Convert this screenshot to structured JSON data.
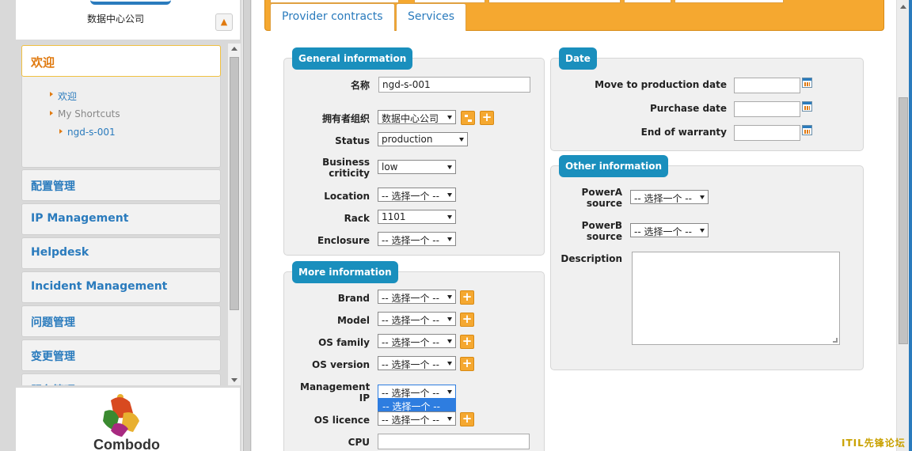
{
  "sidebar": {
    "org_name": "数据中心公司",
    "welcome": {
      "title": "欢迎",
      "shortcuts": [
        "欢迎",
        "My Shortcuts",
        "ngd-s-001"
      ]
    },
    "menu_items": [
      "配置管理",
      "IP Management",
      "Helpdesk",
      "Incident Management",
      "问题管理",
      "变更管理",
      "服务管理"
    ],
    "logo_text": "Combodo"
  },
  "tabs": [
    "Provider contracts",
    "Services"
  ],
  "general": {
    "legend": "General information",
    "name_label": "名称",
    "name_value": "ngd-s-001",
    "org_label": "拥有者组织",
    "org_value": "数据中心公司",
    "status_label": "Status",
    "status_value": "production",
    "criticity_label_1": "Business",
    "criticity_label_2": "criticity",
    "criticity_value": "low",
    "location_label": "Location",
    "location_value": "-- 选择一个 --",
    "rack_label": "Rack",
    "rack_value": "1101",
    "enclosure_label": "Enclosure",
    "enclosure_value": "-- 选择一个 --"
  },
  "more": {
    "legend": "More information",
    "brand_label": "Brand",
    "brand_value": "-- 选择一个 --",
    "model_label": "Model",
    "model_value": "-- 选择一个 --",
    "osfamily_label": "OS family",
    "osfamily_value": "-- 选择一个 --",
    "osversion_label": "OS version",
    "osversion_value": "-- 选择一个 --",
    "mgmtip_label_1": "Management",
    "mgmtip_label_2": "IP",
    "mgmtip_value": "-- 选择一个 --",
    "mgmtip_option": "-- 选择一个 --",
    "oslicence_label": "OS licence",
    "oslicence_value": "-- 选择一个 --",
    "cpu_label": "CPU",
    "cpu_value": ""
  },
  "date": {
    "legend": "Date",
    "move_label": "Move to production date",
    "purchase_label": "Purchase date",
    "warranty_label": "End of warranty"
  },
  "other": {
    "legend": "Other information",
    "powera_label_1": "PowerA",
    "powera_label_2": "source",
    "powera_value": "-- 选择一个 --",
    "powerb_label_1": "PowerB",
    "powerb_label_2": "source",
    "powerb_value": "-- 选择一个 --",
    "description_label": "Description"
  },
  "watermark": "ITIL先锋论坛",
  "colors": {
    "accent": "#f5a830",
    "legend": "#1a8fbd",
    "link": "#2a7bbd",
    "welcome": "#e07a10"
  },
  "icons": [
    "pin-icon",
    "shortcut-arrow-icon",
    "calendar-icon",
    "add-icon",
    "tree-icon",
    "resize-grip-icon"
  ]
}
